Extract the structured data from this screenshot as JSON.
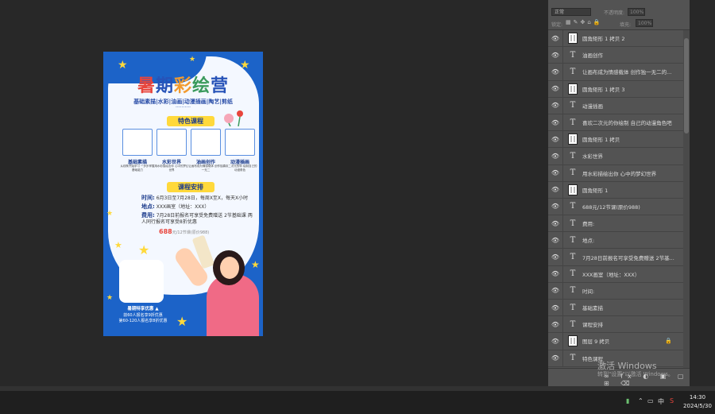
{
  "poster": {
    "title_chars": [
      "暑",
      "期",
      "彩",
      "绘",
      "营"
    ],
    "subtitle": "基础素描|水彩|油画|动漫插画|陶艺|剪纸",
    "dots": "··········",
    "section1": "特色课程",
    "courses": [
      {
        "name": "基础素描",
        "desc": "从线条开始学习 一步步掌握基础能力"
      },
      {
        "name": "水彩世界",
        "desc": "用水彩描绘出你 心中的梦幻世界"
      },
      {
        "name": "油画创作",
        "desc": "让画布成为情感载体 创作独一无二"
      },
      {
        "name": "动漫插画",
        "desc": "喜欢二次元的你 绘制自己的动漫角色"
      }
    ],
    "section2": "课程安排",
    "time_label": "时间:",
    "time_value": "6月3日至7月28日，每周X至X，每天X小时",
    "place_label": "地点:",
    "place_value": "XXX画室（地址：XXX）",
    "fee_label": "费用:",
    "fee_value": "7月28日前报名可享受免费赠送 2节基础课 两人同行报名可享受8折优惠",
    "price": "688",
    "price_suffix": "元/12节课(原价988)",
    "offer_title": "暑期特享优惠 ▲",
    "offer_line1": "前60人报名享9折优惠",
    "offer_line2": "第60-120人报名享8折优惠"
  },
  "panel": {
    "mode": "正常",
    "opacity_label": "不透明度:",
    "opacity_value": "100%",
    "lock_label": "锁定:",
    "fill_label": "填充:",
    "fill_value": "100%",
    "layers": [
      {
        "type": "shape",
        "name": "圆角矩形 1 拷贝 2"
      },
      {
        "type": "text",
        "name": "油画创作"
      },
      {
        "type": "text",
        "name": "让画布成为情感载体 创作独一无二的..."
      },
      {
        "type": "shape",
        "name": "圆角矩形 1 拷贝 3"
      },
      {
        "type": "text",
        "name": "动漫插画"
      },
      {
        "type": "text",
        "name": "喜欢二次元的你绘制 自己的动漫角色吧"
      },
      {
        "type": "shape",
        "name": "圆角矩形 1 拷贝"
      },
      {
        "type": "text",
        "name": "水彩世界"
      },
      {
        "type": "text",
        "name": "用水彩描绘出你 心中的梦幻世界"
      },
      {
        "type": "shape",
        "name": "圆角矩形 1"
      },
      {
        "type": "text",
        "name": "688元/12节课(原价988)"
      },
      {
        "type": "text",
        "name": "费用:"
      },
      {
        "type": "text",
        "name": "地点:"
      },
      {
        "type": "text",
        "name": "7月28日前报名可享受免费赠送 2节基..."
      },
      {
        "type": "text",
        "name": "XXX画室（地址：XXX）"
      },
      {
        "type": "text",
        "name": "时间:"
      },
      {
        "type": "text",
        "name": "基础素描"
      },
      {
        "type": "text",
        "name": "课程安排"
      },
      {
        "type": "shape",
        "name": "图层 9 拷贝",
        "locked": true
      },
      {
        "type": "text",
        "name": "特色课程"
      }
    ]
  },
  "watermark": {
    "line1": "激活 Windows",
    "line2": "转到\"设置\"以激活 Windows。"
  },
  "taskbar": {
    "ime": "中",
    "time": "14:30",
    "date": "2024/5/30"
  }
}
